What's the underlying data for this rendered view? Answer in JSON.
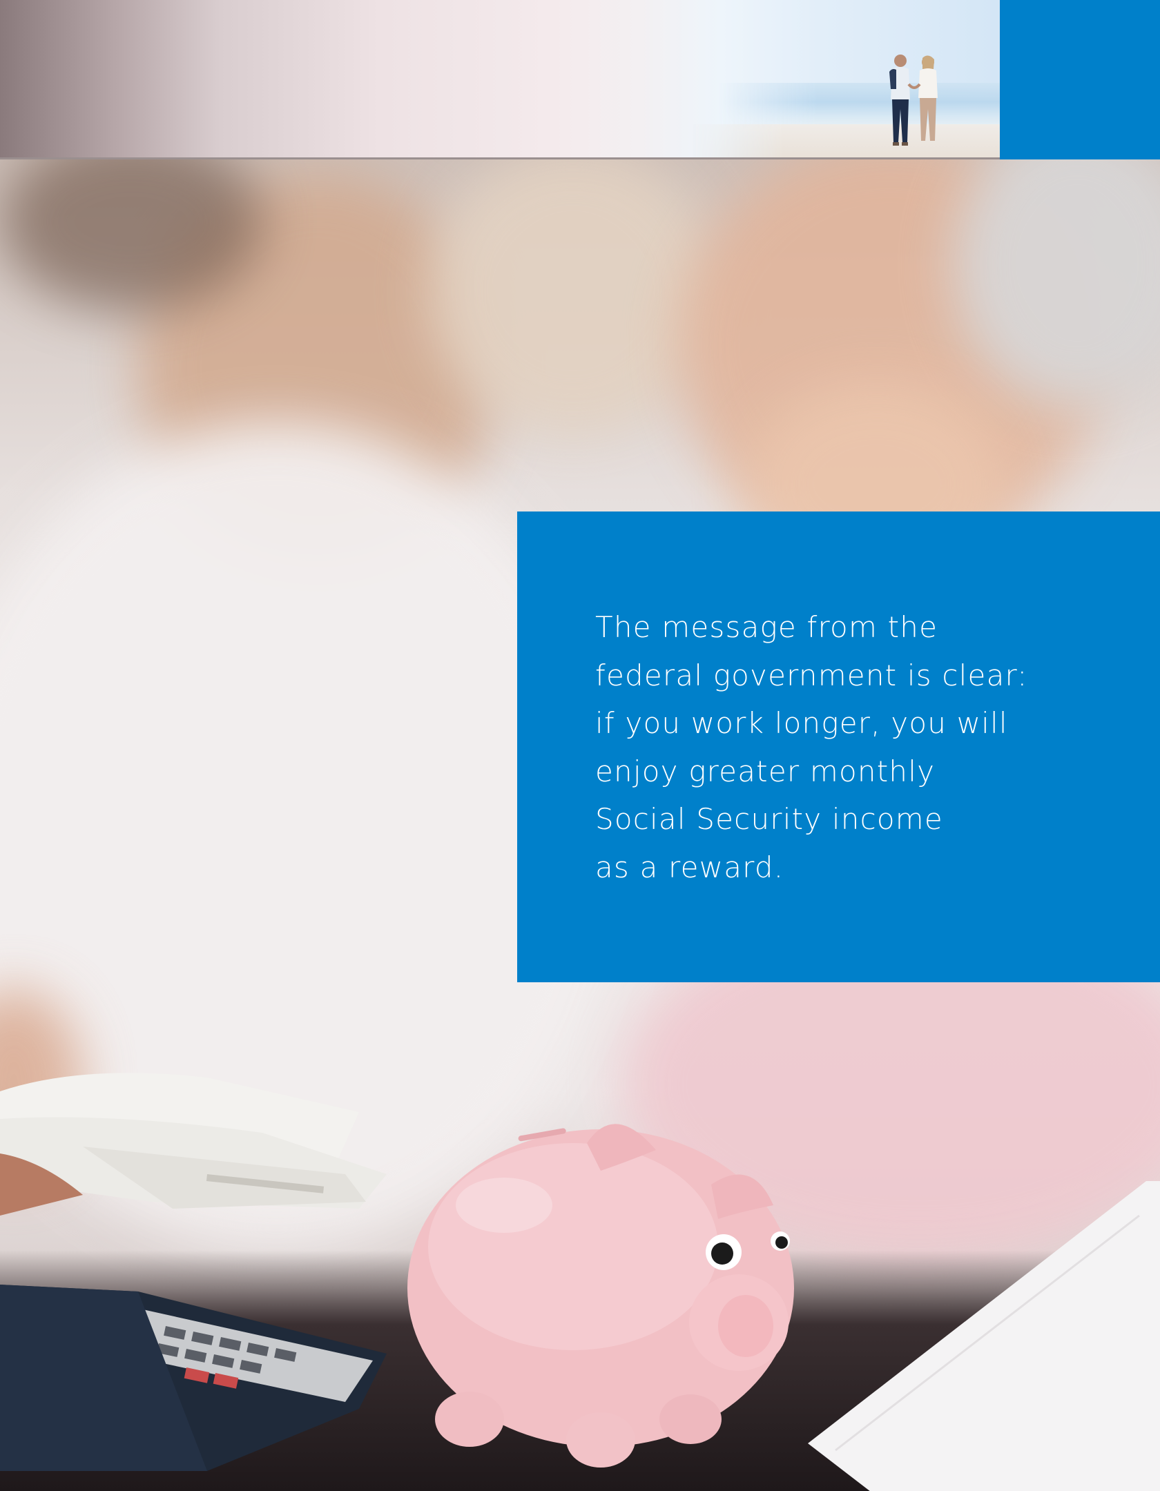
{
  "quote": {
    "lines": [
      "The message from the",
      "federal government is clear:",
      "if you work longer, you will",
      "enjoy greater monthly",
      "Social Security income",
      "as a reward."
    ]
  },
  "colors": {
    "brand_blue": "#0080ca",
    "text_on_blue": "#ffffff",
    "piggy_pink": "#f4c5c9"
  },
  "images": {
    "header_photo": "couple-walking-on-beach",
    "main_photo": "senior-couple-with-piggy-bank-calculator-and-cash"
  }
}
